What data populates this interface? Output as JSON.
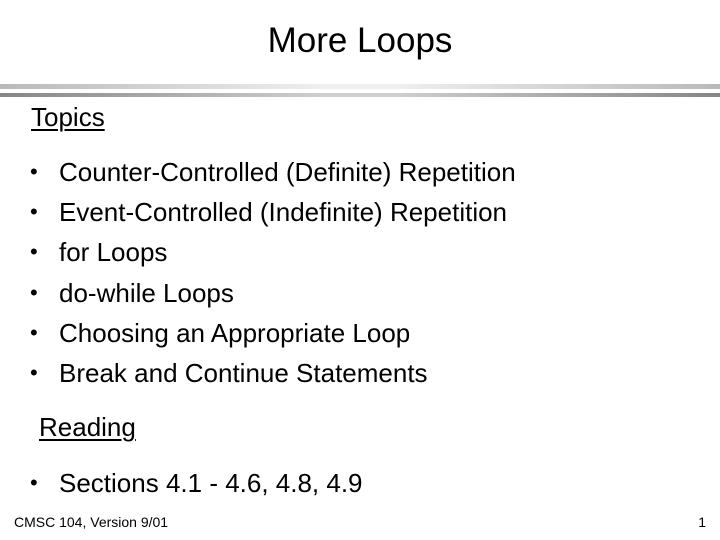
{
  "slide": {
    "title": "More Loops",
    "topics": {
      "heading": "Topics",
      "bullet_glyph": "•",
      "items": [
        "Counter-Controlled (Definite) Repetition",
        "Event-Controlled (Indefinite) Repetition",
        "for Loops",
        "do-while Loops",
        "Choosing an Appropriate Loop",
        "Break and Continue Statements"
      ]
    },
    "reading": {
      "heading": "Reading",
      "bullet_glyph": "•",
      "items": [
        "Sections 4.1 - 4.6, 4.8, 4.9"
      ]
    },
    "footer": {
      "course": "CMSC 104, Version 9/01",
      "page_number": "1"
    }
  }
}
